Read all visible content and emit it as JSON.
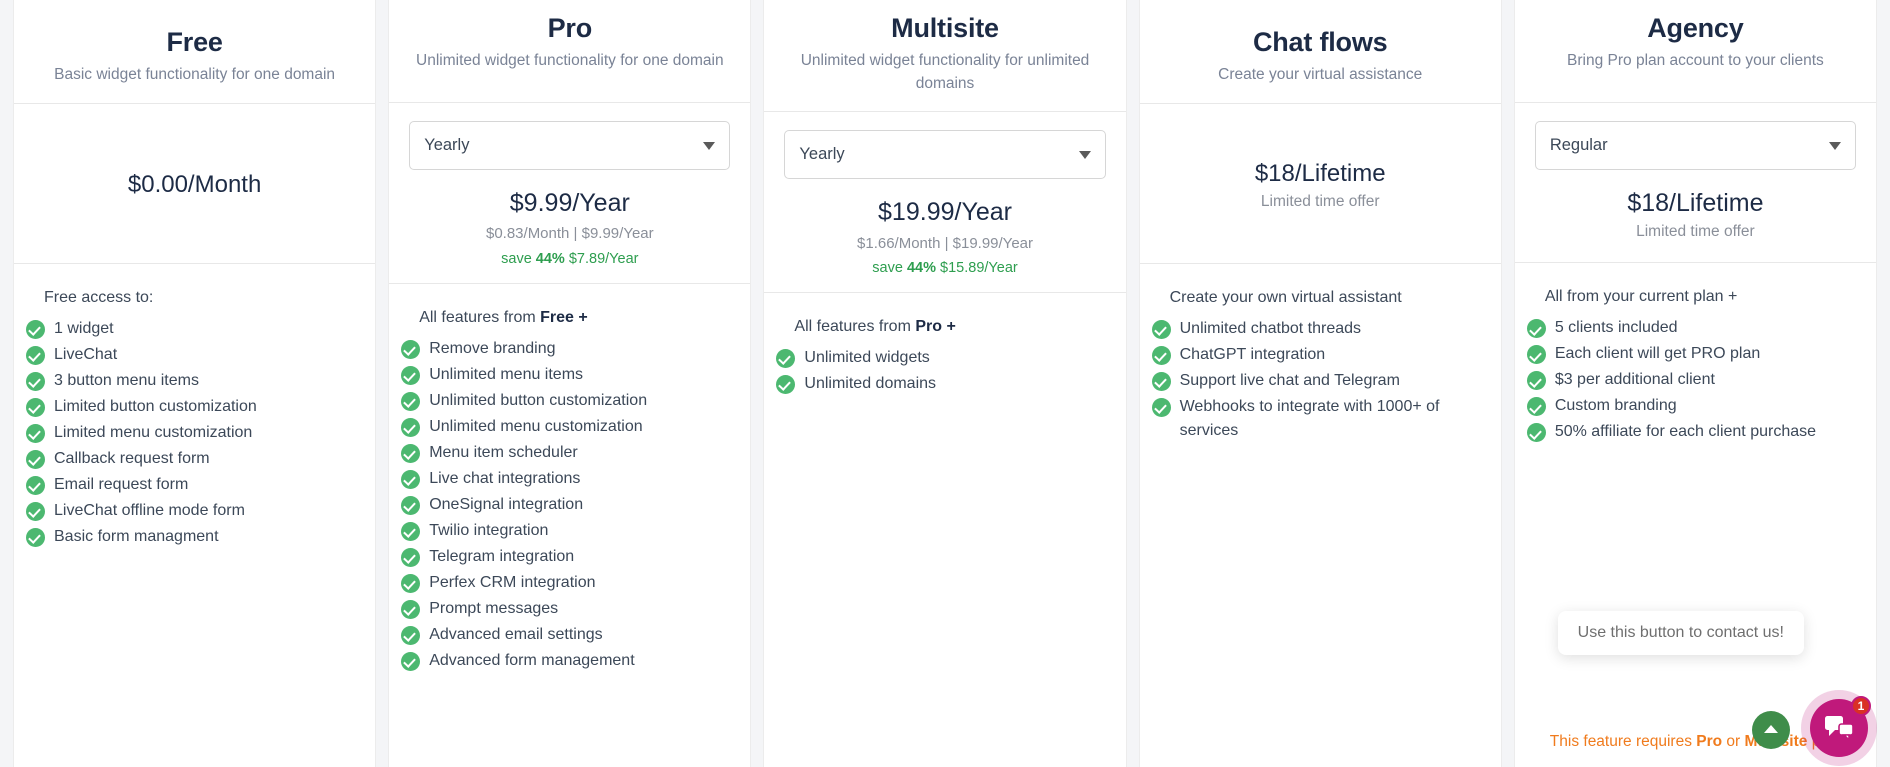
{
  "plans": [
    {
      "id": "free",
      "title": "Free",
      "subtitle": "Basic widget functionality for one domain",
      "has_select": false,
      "price_main": "$0.00/Month",
      "features_lead": "Free access to:",
      "features_lead_bold": "",
      "features_lead_tail": "",
      "features": [
        "1 widget",
        "LiveChat",
        "3 button menu items",
        "Limited button customization",
        "Limited menu customization",
        "Callback request form",
        "Email request form",
        "LiveChat offline mode form",
        "Basic form managment"
      ]
    },
    {
      "id": "pro",
      "title": "Pro",
      "subtitle": "Unlimited widget functionality for one domain",
      "has_select": true,
      "select_value": "Yearly",
      "price_main": "$9.99/Year",
      "price_detail": "$0.83/Month  |  $9.99/Year",
      "save_label": "save",
      "save_percent": "44%",
      "save_amount": "$7.89/Year",
      "features_lead": "All features from ",
      "features_lead_bold": "Free +",
      "features_lead_tail": "",
      "features": [
        "Remove branding",
        "Unlimited menu items",
        "Unlimited button customization",
        "Unlimited menu customization",
        "Menu item scheduler",
        "Live chat integrations",
        "OneSignal integration",
        "Twilio integration",
        "Telegram integration",
        "Perfex CRM integration",
        "Prompt messages",
        "Advanced email settings",
        "Advanced form management"
      ]
    },
    {
      "id": "multisite",
      "title": "Multisite",
      "subtitle": "Unlimited widget functionality for unlimited domains",
      "has_select": true,
      "select_value": "Yearly",
      "price_main": "$19.99/Year",
      "price_detail": "$1.66/Month  |  $19.99/Year",
      "save_label": "save",
      "save_percent": "44%",
      "save_amount": "$15.89/Year",
      "features_lead": "All features from ",
      "features_lead_bold": "Pro +",
      "features_lead_tail": "",
      "features": [
        "Unlimited widgets",
        "Unlimited domains"
      ]
    },
    {
      "id": "chat-flows",
      "title": "Chat flows",
      "subtitle": "Create your virtual assistance",
      "has_select": false,
      "price_main": "$18/Lifetime",
      "price_note": "Limited time offer",
      "features_lead": "Create your own virtual assistant",
      "features_lead_bold": "",
      "features_lead_tail": "",
      "features": [
        "Unlimited chatbot threads",
        "ChatGPT integration",
        "Support live chat and Telegram",
        "Webhooks to integrate with 1000+ of services"
      ]
    },
    {
      "id": "agency",
      "title": "Agency",
      "subtitle": "Bring Pro plan account to your clients",
      "has_select": true,
      "select_value": "Regular",
      "price_main": "$18/Lifetime",
      "price_note": "Limited time offer",
      "features_lead": "All from your current plan +",
      "features_lead_bold": "",
      "features_lead_tail": "",
      "features": [
        "5 clients included",
        "Each client will get PRO plan",
        "$3 per additional client",
        "Custom branding",
        "50% affiliate for each client purchase"
      ],
      "upsell": {
        "prefix": "This feature requires ",
        "plan_a": "Pro",
        "middle": " or ",
        "plan_b": "Multisite",
        "suffix": " plan"
      }
    }
  ],
  "widgets": {
    "tooltip_text": "Use this button to contact us!",
    "chat_badge_count": "1",
    "scroll_top_icon": "chevron-up-icon",
    "chat_icon": "chat-bubbles-icon"
  },
  "colors": {
    "check_green": "#4cb870",
    "save_green": "#2e9e4f",
    "title_navy": "#1d2b45",
    "upsell_orange": "#f07b1d",
    "chat_pink": "#c0197b",
    "scroll_green": "#3f8d4a",
    "badge_red": "#d93025"
  }
}
